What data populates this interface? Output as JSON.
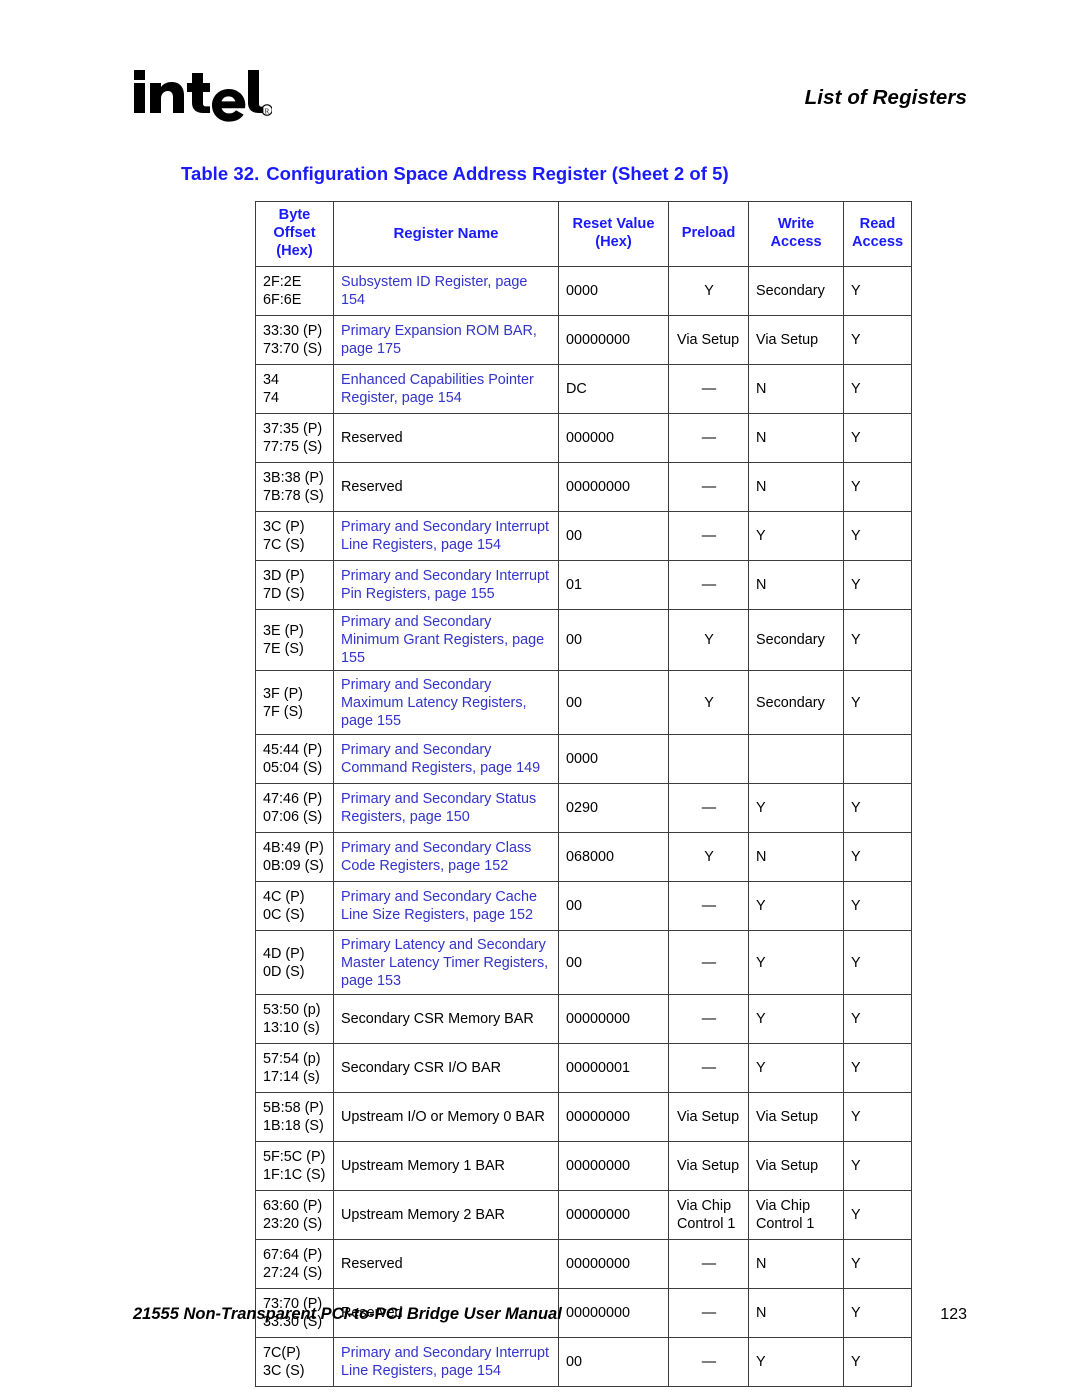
{
  "header": {
    "running_head": "List of Registers",
    "logo_name": "intel-logo",
    "logo_text": "intel"
  },
  "caption": {
    "number": "Table 32.",
    "text": "Configuration Space Address Register  (Sheet 2 of 5)"
  },
  "table": {
    "columns": [
      "Byte\nOffset\n(Hex)",
      "Register Name",
      "Reset Value\n(Hex)",
      "Preload",
      "Write\nAccess",
      "Read\nAccess"
    ],
    "rows": [
      {
        "offset": "2F:2E\n6F:6E",
        "name": "Subsystem ID Register, page 154",
        "name_link": true,
        "reset": "0000",
        "preload": "Y",
        "write": "Secondary",
        "read": "Y",
        "tall": false
      },
      {
        "offset": "33:30 (P)\n73:70 (S)",
        "name": "Primary Expansion ROM BAR, page 175",
        "name_link": true,
        "reset": "00000000",
        "preload": "Via Setup",
        "write": "Via Setup",
        "read": "Y",
        "tall": false
      },
      {
        "offset": "34\n74",
        "name": "Enhanced Capabilities Pointer Register, page 154",
        "name_link": true,
        "reset": "DC",
        "preload": "—",
        "write": "N",
        "read": "Y",
        "tall": false
      },
      {
        "offset": "37:35 (P)\n77:75 (S)",
        "name": "Reserved",
        "name_link": false,
        "reset": "000000",
        "preload": "—",
        "write": "N",
        "read": "Y",
        "tall": false
      },
      {
        "offset": "3B:38 (P)\n7B:78 (S)",
        "name": "Reserved",
        "name_link": false,
        "reset": "00000000",
        "preload": "—",
        "write": "N",
        "read": "Y",
        "tall": false
      },
      {
        "offset": "3C (P)\n7C (S)",
        "name": "Primary and Secondary Interrupt Line Registers, page 154",
        "name_link": true,
        "reset": "00",
        "preload": "—",
        "write": "Y",
        "read": "Y",
        "tall": false
      },
      {
        "offset": "3D (P)\n7D (S)",
        "name": "Primary and Secondary Interrupt Pin Registers, page 155",
        "name_link": true,
        "reset": "01",
        "preload": "—",
        "write": "N",
        "read": "Y",
        "tall": false
      },
      {
        "offset": "3E (P)\n7E (S)",
        "name": "Primary and Secondary Minimum Grant Registers, page 155",
        "name_link": true,
        "reset": "00",
        "preload": "Y",
        "write": "Secondary",
        "read": "Y",
        "tall": false
      },
      {
        "offset": "3F (P)\n7F (S)",
        "name": "Primary and Secondary Maximum Latency Registers, page 155",
        "name_link": true,
        "reset": "00",
        "preload": "Y",
        "write": "Secondary",
        "read": "Y",
        "tall": true
      },
      {
        "offset": "45:44 (P)\n05:04 (S)",
        "name": "Primary and Secondary Command Registers, page 149",
        "name_link": true,
        "reset": "0000",
        "preload": "",
        "write": "",
        "read": "",
        "tall": false
      },
      {
        "offset": "47:46 (P)\n07:06 (S)",
        "name": "Primary and Secondary Status Registers, page 150",
        "name_link": true,
        "reset": "0290",
        "preload": "—",
        "write": "Y",
        "read": "Y",
        "tall": false
      },
      {
        "offset": "4B:49 (P)\n0B:09 (S)",
        "name": "Primary and Secondary Class Code Registers, page 152",
        "name_link": true,
        "reset": "068000",
        "preload": "Y",
        "write": "N",
        "read": "Y",
        "tall": false
      },
      {
        "offset": "4C (P)\n0C (S)",
        "name": "Primary and Secondary Cache Line Size Registers, page 152",
        "name_link": true,
        "reset": "00",
        "preload": "—",
        "write": "Y",
        "read": "Y",
        "tall": false
      },
      {
        "offset": "4D (P)\n0D (S)",
        "name": "Primary Latency and Secondary Master Latency Timer Registers, page 153",
        "name_link": true,
        "reset": "00",
        "preload": "—",
        "write": "Y",
        "read": "Y",
        "tall": true
      },
      {
        "offset": "53:50 (p)\n13:10 (s)",
        "name": "Secondary CSR Memory BAR",
        "name_link": false,
        "reset": "00000000",
        "preload": "—",
        "write": "Y",
        "read": "Y",
        "tall": false
      },
      {
        "offset": "57:54 (p)\n17:14 (s)",
        "name": "Secondary CSR I/O BAR",
        "name_link": false,
        "reset": "00000001",
        "preload": "—",
        "write": "Y",
        "read": "Y",
        "tall": false
      },
      {
        "offset": "5B:58 (P)\n1B:18 (S)",
        "name": "Upstream I/O or Memory 0 BAR",
        "name_link": false,
        "reset": "00000000",
        "preload": "Via Setup",
        "write": "Via Setup",
        "read": "Y",
        "tall": false
      },
      {
        "offset": "5F:5C (P)\n1F:1C (S)",
        "name": "Upstream Memory 1 BAR",
        "name_link": false,
        "reset": "00000000",
        "preload": "Via Setup",
        "write": "Via Setup",
        "read": "Y",
        "tall": false
      },
      {
        "offset": "63:60 (P)\n23:20 (S)",
        "name": "Upstream Memory 2 BAR",
        "name_link": false,
        "reset": "00000000",
        "preload": "Via Chip Control 1",
        "write": "Via Chip Control 1",
        "read": "Y",
        "tall": false
      },
      {
        "offset": "67:64 (P)\n27:24 (S)",
        "name": "Reserved",
        "name_link": false,
        "reset": "00000000",
        "preload": "—",
        "write": "N",
        "read": "Y",
        "tall": false
      },
      {
        "offset": "73:70 (P)\n33:30 (S)",
        "name": "Reserved",
        "name_link": false,
        "reset": "00000000",
        "preload": "—",
        "write": "N",
        "read": "Y",
        "tall": false
      },
      {
        "offset": "7C(P)\n3C (S)",
        "name": "Primary and Secondary Interrupt Line Registers, page 154",
        "name_link": true,
        "reset": "00",
        "preload": "—",
        "write": "Y",
        "read": "Y",
        "tall": false
      }
    ]
  },
  "footer": {
    "title": "21555 Non-Transparent PCI-to-PCI Bridge User Manual",
    "page_number": "123"
  },
  "colors": {
    "link_blue": "#3333cc",
    "heading_blue": "#1a1aff",
    "border": "#3c3c3c"
  }
}
